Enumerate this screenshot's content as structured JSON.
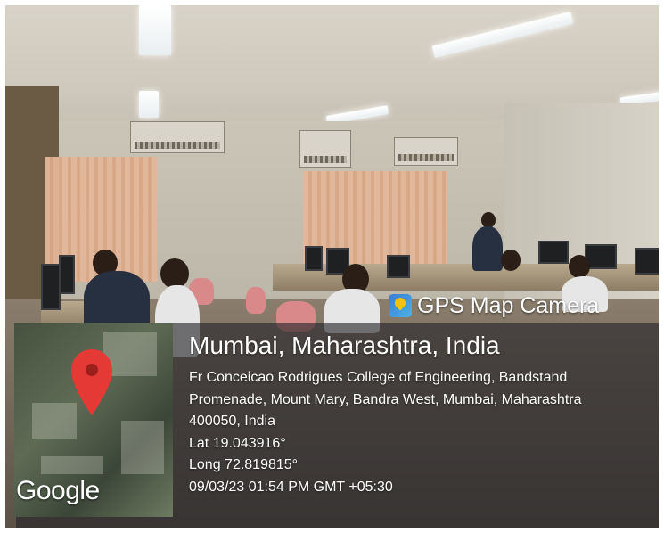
{
  "photo": {
    "scene": "computer-lab",
    "colors": {
      "overlay": "#232328",
      "pin": "#e53935",
      "brand_icon": "#3a7bd5"
    }
  },
  "watermark": {
    "brand": "GPS Map Camera",
    "brand_icon": "gps-map-camera-icon",
    "city": "Mumbai, Maharashtra, India",
    "address_lines": [
      "Fr Conceicao Rodrigues College of Engineering, Bandstand",
      "Promenade, Mount Mary, Bandra West, Mumbai, Maharashtra",
      "400050, India"
    ],
    "lat": "Lat 19.043916°",
    "long": "Long 72.819815°",
    "datetime": "09/03/23 01:54 PM GMT +05:30"
  },
  "map": {
    "attribution": "Google",
    "marker_icon": "map-pin-icon"
  }
}
